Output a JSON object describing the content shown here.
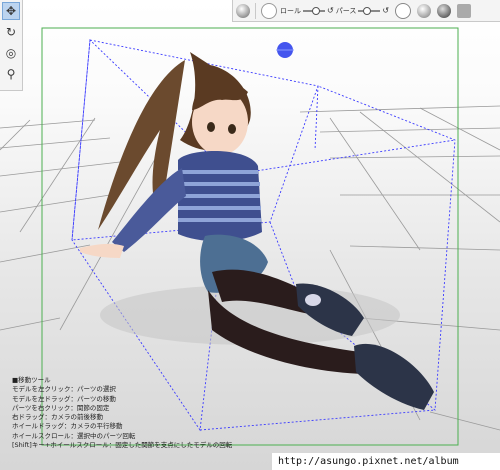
{
  "toolbar_top": {
    "roll_label": "ロール",
    "perspective_label": "パース",
    "roll_value": 0.55,
    "perspective_value": 0.35
  },
  "left_tools": [
    {
      "icon": "move-cross-icon",
      "active": true
    },
    {
      "icon": "rotate-icon",
      "active": false
    },
    {
      "icon": "camera-orbit-icon",
      "active": false
    },
    {
      "icon": "joint-pin-icon",
      "active": false
    }
  ],
  "instructions": {
    "title": "■移動ツール",
    "lines": [
      "モデルを左クリック：パーツの選択",
      "モデルを左ドラッグ：パーツの移動",
      "パーツを右クリック：関節の固定",
      "右ドラッグ：カメラの前後移動",
      "ホイールドラッグ：カメラの平行移動",
      "ホイールスクロール：選択中のパーツ回転",
      "[Shift]キー+ホイールスクロール：固定した関節を支点にしたモデルの回転"
    ]
  },
  "watermark": "http://asungo.pixnet.net/album",
  "colors": {
    "frame_green": "#4caf50",
    "bbox_blue": "#3a3aff",
    "handle_blue": "#4455ee",
    "toolbar_bg": "#f4f4f4"
  }
}
